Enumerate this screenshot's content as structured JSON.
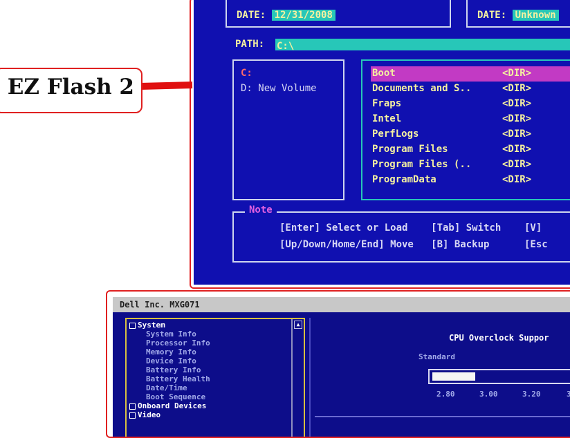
{
  "callout": {
    "label": "EZ Flash 2"
  },
  "ez_flash": {
    "date_label": "DATE:",
    "current_date": "12/31/2008",
    "new_date": "Unknown",
    "path_label": "PATH:",
    "path_value": "C:\\",
    "drives": [
      "C:",
      "D: New Volume"
    ],
    "files": [
      {
        "name": "Boot",
        "type": "<DIR>",
        "selected": true
      },
      {
        "name": "Documents and S..",
        "type": "<DIR>",
        "selected": false
      },
      {
        "name": "Fraps",
        "type": "<DIR>",
        "selected": false
      },
      {
        "name": "Intel",
        "type": "<DIR>",
        "selected": false
      },
      {
        "name": "PerfLogs",
        "type": "<DIR>",
        "selected": false
      },
      {
        "name": "Program Files",
        "type": "<DIR>",
        "selected": false
      },
      {
        "name": "Program Files (..",
        "type": "<DIR>",
        "selected": false
      },
      {
        "name": "ProgramData",
        "type": "<DIR>",
        "selected": false
      }
    ],
    "note_title": "Note",
    "note_lines": [
      "[Enter] Select or Load    [Tab] Switch    [V]",
      "[Up/Down/Home/End] Move   [B] Backup      [Esc"
    ]
  },
  "dell": {
    "title": "Dell Inc. MXG071",
    "tree": [
      {
        "label": "System",
        "category": true
      },
      {
        "label": "System Info",
        "category": false
      },
      {
        "label": "Processor Info",
        "category": false
      },
      {
        "label": "Memory Info",
        "category": false
      },
      {
        "label": "Device Info",
        "category": false
      },
      {
        "label": "Battery Info",
        "category": false
      },
      {
        "label": "Battery Health",
        "category": false
      },
      {
        "label": "Date/Time",
        "category": false
      },
      {
        "label": "Boot Sequence",
        "category": false
      },
      {
        "label": "Onboard Devices",
        "category": true
      },
      {
        "label": "Video",
        "category": true
      }
    ],
    "panel_title": "CPU Overclock Suppor",
    "standard_label": "Standard",
    "ticks": [
      "2.80",
      "3.00",
      "3.20",
      "3."
    ],
    "colors": {
      "bios_blue": "#1010b0",
      "selection": "#c23ac4",
      "cyan": "#27c7b8",
      "dell_blue": "#0d0d8a"
    }
  }
}
